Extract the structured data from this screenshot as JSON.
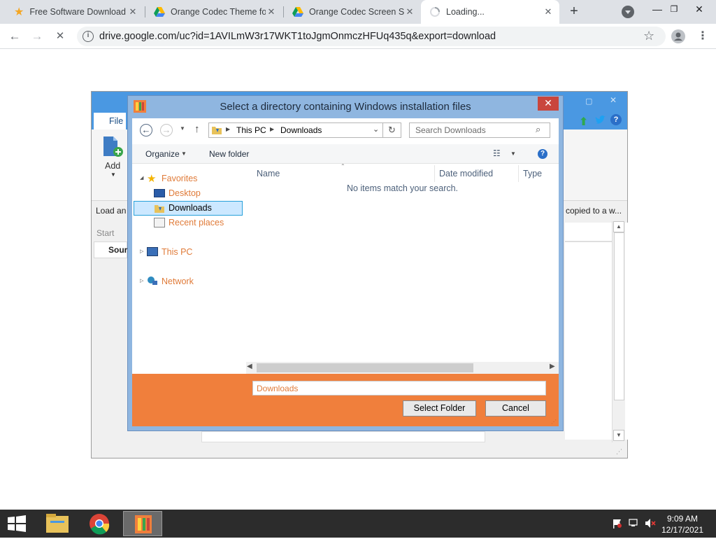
{
  "browser": {
    "tabs": [
      {
        "title": "Free Software Download",
        "icon": "star-icon"
      },
      {
        "title": "Orange Codec Theme fo",
        "icon": "google-drive-icon"
      },
      {
        "title": "Orange Codec Screen Sa",
        "icon": "google-drive-icon"
      },
      {
        "title": "Loading...",
        "icon": "spinner-icon"
      }
    ],
    "url": "drive.google.com/uc?id=1AVILmW3r17WKT1toJgmOnmczHFUq435q&export=download"
  },
  "app": {
    "menu_file": "File",
    "add_label": "Add",
    "load_text": "Load an",
    "copied_text": "copied to a w...",
    "start_label": "Start",
    "source_label": "Sour"
  },
  "dialog": {
    "title": "Select a directory containing Windows installation files",
    "breadcrumb": [
      "This PC",
      "Downloads"
    ],
    "search_placeholder": "Search Downloads",
    "organize": "Organize",
    "new_folder": "New folder",
    "nav": {
      "favorites": "Favorites",
      "desktop": "Desktop",
      "downloads": "Downloads",
      "recent": "Recent places",
      "this_pc": "This PC",
      "network": "Network"
    },
    "columns": [
      "Name",
      "Date modified",
      "Type"
    ],
    "empty_message": "No items match your search.",
    "folder_value": "Downloads",
    "select_button": "Select Folder",
    "cancel_button": "Cancel"
  },
  "taskbar": {
    "time": "9:09 AM",
    "date": "12/17/2021"
  },
  "colors": {
    "accent_orange": "#f07f3c",
    "app_blue": "#4a98e2",
    "close_red": "#c9463d"
  }
}
